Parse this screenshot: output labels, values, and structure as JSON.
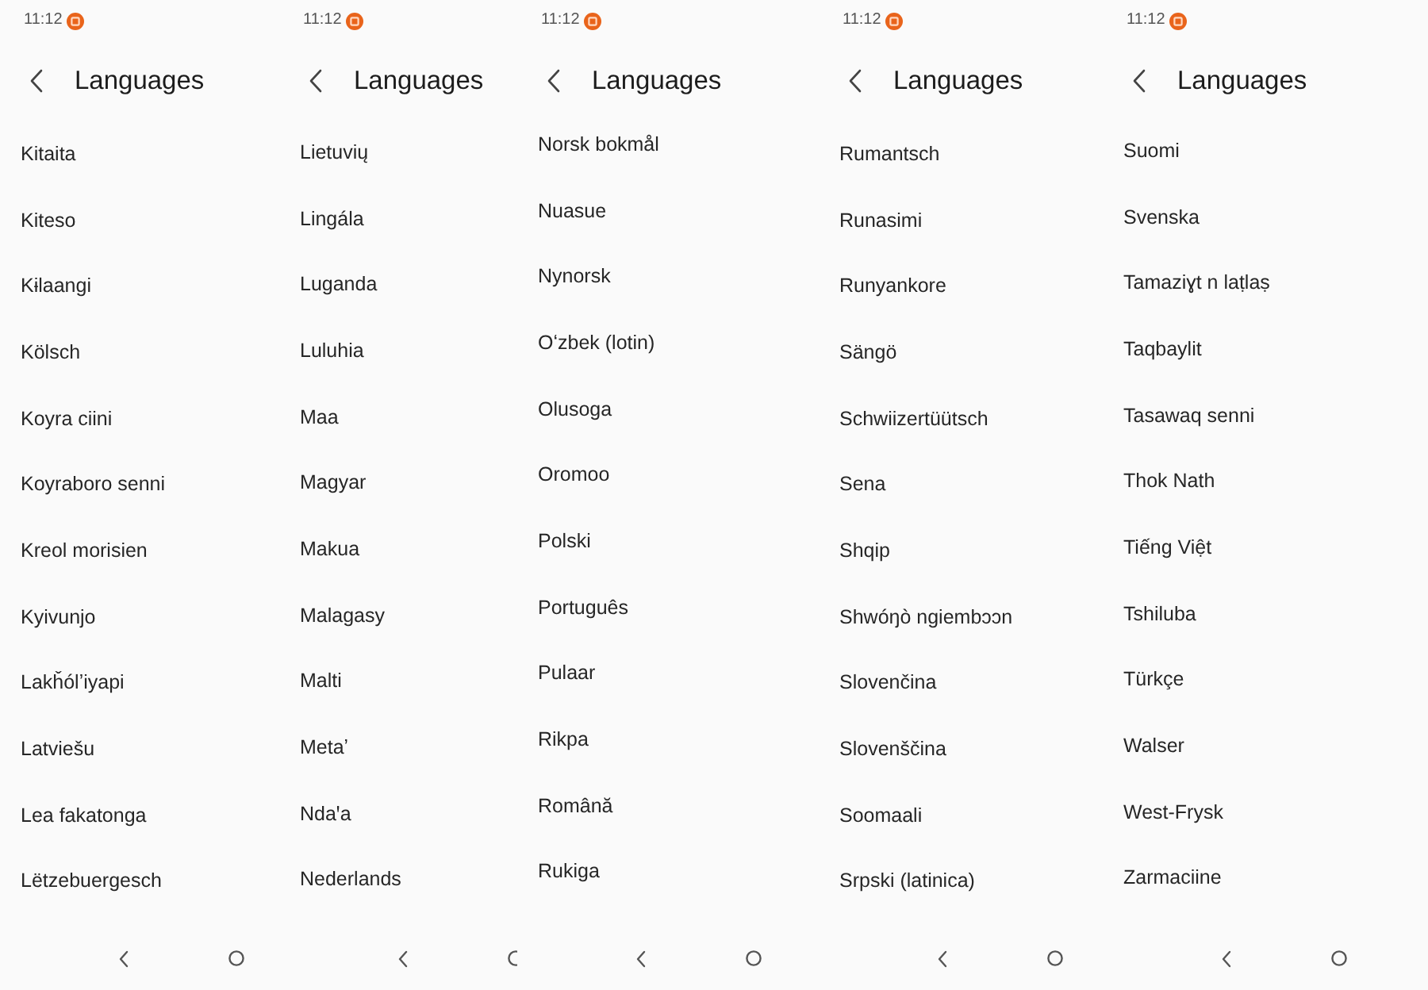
{
  "screens": [
    {
      "status_bar": {
        "time": "11:12"
      },
      "header": {
        "title": "Languages"
      },
      "items": [
        {
          "label": "Kitaita"
        },
        {
          "label": "Kiteso"
        },
        {
          "label": "Kɨlaangi"
        },
        {
          "label": "Kölsch"
        },
        {
          "label": "Koyra ciini"
        },
        {
          "label": "Koyraboro senni"
        },
        {
          "label": "Kreol morisien"
        },
        {
          "label": "Kyivunjo"
        },
        {
          "label": "Lakȟólʼiyapi"
        },
        {
          "label": "Latviešu"
        },
        {
          "label": "Lea fakatonga"
        },
        {
          "label": "Lëtzebuergesch"
        }
      ]
    },
    {
      "status_bar": {
        "time": "11:12"
      },
      "header": {
        "title": "Languages"
      },
      "items": [
        {
          "label": "Lietuvių"
        },
        {
          "label": "Lingála"
        },
        {
          "label": "Luganda"
        },
        {
          "label": "Luluhia"
        },
        {
          "label": "Maa"
        },
        {
          "label": "Magyar"
        },
        {
          "label": "Makua"
        },
        {
          "label": "Malagasy"
        },
        {
          "label": "Malti"
        },
        {
          "label": "Metaʼ"
        },
        {
          "label": "Ndaꞌa"
        },
        {
          "label": "Nederlands"
        }
      ]
    },
    {
      "status_bar": {
        "time": "11:12"
      },
      "header": {
        "title": "Languages"
      },
      "items": [
        {
          "label": "Norsk bokmål"
        },
        {
          "label": "Nuasue"
        },
        {
          "label": "Nynorsk"
        },
        {
          "label": "Oʻzbek (lotin)"
        },
        {
          "label": "Olusoga"
        },
        {
          "label": "Oromoo"
        },
        {
          "label": "Polski"
        },
        {
          "label": "Português"
        },
        {
          "label": "Pulaar"
        },
        {
          "label": "Rikpa"
        },
        {
          "label": "Română"
        },
        {
          "label": "Rukiga"
        }
      ]
    },
    {
      "status_bar": {
        "time": "11:12"
      },
      "header": {
        "title": "Languages"
      },
      "items": [
        {
          "label": "Rumantsch"
        },
        {
          "label": "Runasimi"
        },
        {
          "label": "Runyankore"
        },
        {
          "label": "Sängö"
        },
        {
          "label": "Schwiizertüütsch"
        },
        {
          "label": "Sena"
        },
        {
          "label": "Shqip"
        },
        {
          "label": "Shwóŋò ngiembɔɔn"
        },
        {
          "label": "Slovenčina"
        },
        {
          "label": "Slovenščina"
        },
        {
          "label": "Soomaali"
        },
        {
          "label": "Srpski (latinica)"
        }
      ]
    },
    {
      "status_bar": {
        "time": "11:12"
      },
      "header": {
        "title": "Languages"
      },
      "items": [
        {
          "label": "Suomi"
        },
        {
          "label": "Svenska"
        },
        {
          "label": "Tamaziɣt n laṭlaṣ"
        },
        {
          "label": "Taqbaylit"
        },
        {
          "label": "Tasawaq senni"
        },
        {
          "label": "Thok Nath"
        },
        {
          "label": "Tiếng Việt"
        },
        {
          "label": "Tshiluba"
        },
        {
          "label": "Türkçe"
        },
        {
          "label": "Walser"
        },
        {
          "label": "West-Frysk"
        },
        {
          "label": "Zarmaciine"
        }
      ]
    }
  ]
}
